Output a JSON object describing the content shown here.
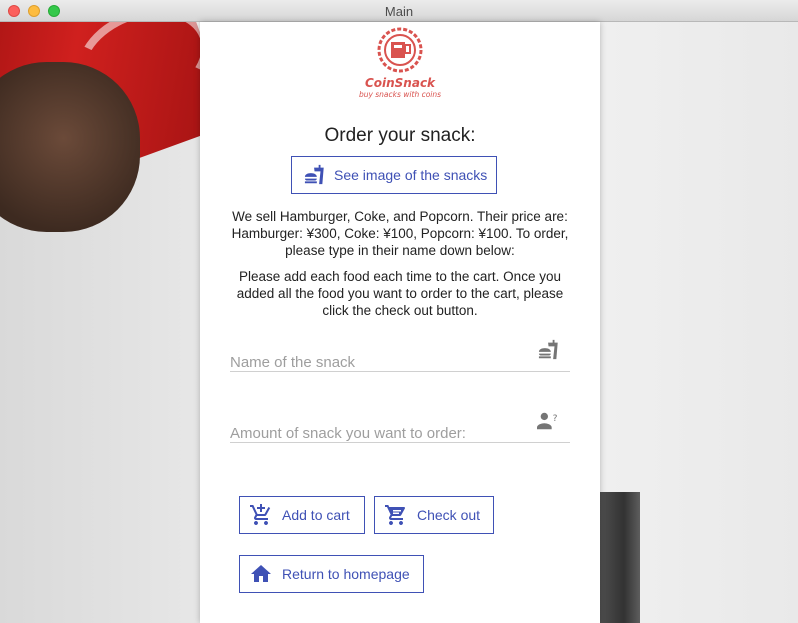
{
  "window": {
    "title": "Main"
  },
  "logo": {
    "name": "CoinSnack",
    "tagline": "buy snacks with coins"
  },
  "page": {
    "heading": "Order your snack:",
    "see_image_label": "See image of the snacks",
    "paragraph1": "We sell Hamburger, Coke, and Popcorn. Their price are: Hamburger: ¥300, Coke: ¥100, Popcorn: ¥100. To order, please type in their name down below:",
    "paragraph2": "Please add each food each time to the cart. Once you added all the food you want to order to the cart, please click the check out button."
  },
  "form": {
    "snack_name_placeholder": "Name of the snack",
    "amount_placeholder": "Amount of snack you want to order:"
  },
  "actions": {
    "add_to_cart": "Add to cart",
    "check_out": "Check out",
    "return_home": "Return to homepage"
  },
  "colors": {
    "accent": "#3f51b5",
    "logo": "#d9534f"
  },
  "icons": {
    "see_image": "fastfood-icon",
    "snack_field": "fastfood-icon",
    "amount_field": "person-question-icon",
    "add_to_cart": "add-shopping-cart-icon",
    "check_out": "shopping-cart-icon",
    "home": "home-icon"
  }
}
